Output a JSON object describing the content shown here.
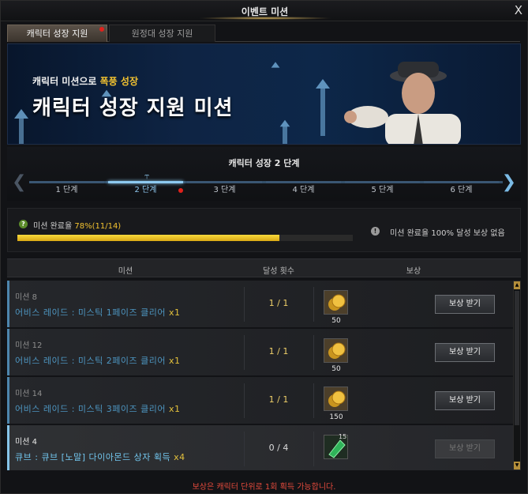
{
  "window": {
    "title": "이벤트 미션",
    "close_label": "X"
  },
  "tabs": [
    {
      "label": "캐릭터 성장 지원",
      "active": true,
      "badge": "red-dot"
    },
    {
      "label": "원정대 성장 지원",
      "active": false
    }
  ],
  "banner": {
    "subtitle_prefix": "캐릭터 미션으로 ",
    "subtitle_highlight": "폭풍 성장",
    "title": "캐릭터 성장 지원 미션"
  },
  "steps": {
    "title": "캐릭터 성장 2 단계",
    "items": [
      {
        "label": "1 단계",
        "active": false
      },
      {
        "label": "2 단계",
        "active": true
      },
      {
        "label": "3 단계",
        "active": false
      },
      {
        "label": "4 단계",
        "active": false
      },
      {
        "label": "5 단계",
        "active": false
      },
      {
        "label": "6 단계",
        "active": false
      }
    ]
  },
  "progress": {
    "label_prefix": "미션 완료율 ",
    "percent_text": "78%(11/14)",
    "percent": 78,
    "info_text": "미션 완료율 100% 달성 보상 없음"
  },
  "table": {
    "headers": {
      "mission": "미션",
      "count": "달성 횟수",
      "reward": "보상"
    },
    "rows": [
      {
        "num": "미션 8",
        "title": "어비스 레이드 : 미스틱 1페이즈 클리어 ",
        "mul": "x1",
        "count": "1 / 1",
        "reward_icon": "gold-coin-icon",
        "reward_qty": "50",
        "button": "보상 받기",
        "state": "done"
      },
      {
        "num": "미션 12",
        "title": "어비스 레이드 : 미스틱 2페이즈 클리어 ",
        "mul": "x1",
        "count": "1 / 1",
        "reward_icon": "gold-coin-icon",
        "reward_qty": "50",
        "button": "보상 받기",
        "state": "done"
      },
      {
        "num": "미션 14",
        "title": "어비스 레이드 : 미스틱 3페이즈 클리어 ",
        "mul": "x1",
        "count": "1 / 1",
        "reward_icon": "gold-coin-icon",
        "reward_qty": "150",
        "button": "보상 받기",
        "state": "done"
      },
      {
        "num": "미션 4",
        "title": "큐브 : 큐브 [노말] 다이아몬드 상자 획득 ",
        "mul": "x4",
        "count": "0 / 4",
        "reward_icon": "green-gem-icon",
        "reward_qty": "15",
        "button": "보상 받기",
        "state": "pending"
      }
    ]
  },
  "footer": "보상은 캐릭터 단위로 1회 획득 가능합니다.",
  "colors": {
    "accent_gold": "#f2c230",
    "accent_blue": "#8ec8ef",
    "warning_red": "#e34a3c"
  }
}
